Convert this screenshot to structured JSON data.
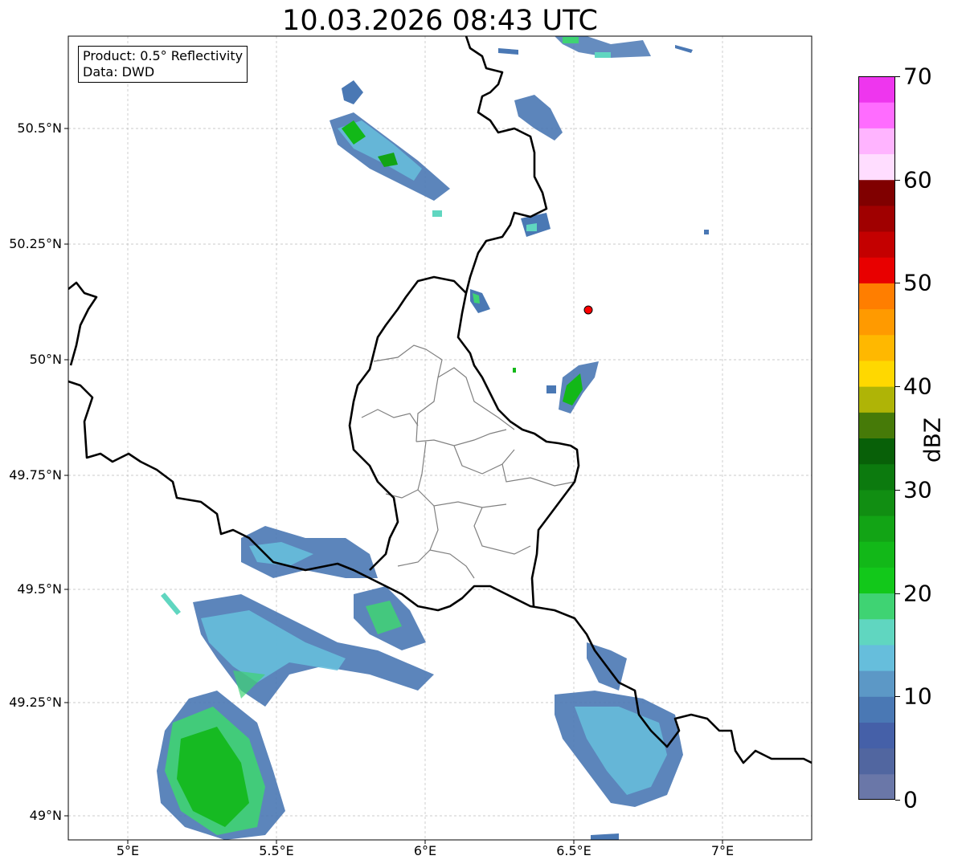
{
  "title": "10.03.2026 08:43 UTC",
  "infobox": {
    "product": "Product: 0.5° Reflectivity",
    "data": "Data: DWD"
  },
  "axes": {
    "lat_labels": [
      "50.5°N",
      "50.25°N",
      "50°N",
      "49.75°N",
      "49.5°N",
      "49.25°N",
      "49°N"
    ],
    "lon_labels": [
      "5°E",
      "5.5°E",
      "6°E",
      "6.5°E",
      "7°E"
    ]
  },
  "colorbar": {
    "label": "dBZ",
    "ticks": [
      "0",
      "10",
      "20",
      "30",
      "40",
      "50",
      "60",
      "70"
    ],
    "colors": [
      "#6a77a8",
      "#5166a0",
      "#4560a8",
      "#4a78b4",
      "#5c98c6",
      "#66bedc",
      "#60d6c0",
      "#3fd373",
      "#12c81a",
      "#12b818",
      "#12a415",
      "#118e12",
      "#0c7a0e",
      "#086008",
      "#467a08",
      "#afb406",
      "#ffd800",
      "#ffb800",
      "#ff9a00",
      "#ff7e00",
      "#e80000",
      "#c40000",
      "#a00000",
      "#800000",
      "#ffddff",
      "#ffb4ff",
      "#ff6cff",
      "#ee36ee"
    ]
  },
  "map": {
    "lon_range": [
      4.8,
      7.3
    ],
    "lat_range": [
      48.95,
      50.7
    ],
    "grid": true,
    "radar_site_color": "#ff0000",
    "radar_site": [
      6.55,
      50.11
    ]
  }
}
